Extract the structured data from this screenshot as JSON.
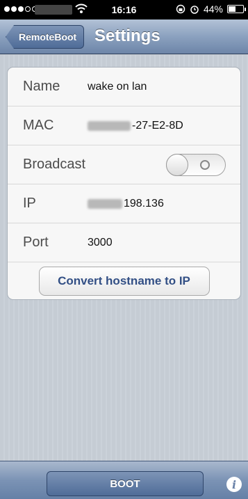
{
  "status_bar": {
    "time": "16:16",
    "battery_percent": "44%",
    "battery_level": 0.44,
    "icons": [
      "signal-icon",
      "wifi-icon",
      "rotation-lock-icon",
      "alarm-icon",
      "battery-icon"
    ]
  },
  "nav": {
    "back_label": "RemoteBoot",
    "title": "Settings"
  },
  "settings": {
    "name_label": "Name",
    "name_value": "wake on lan",
    "mac_label": "MAC",
    "mac_value": "-27-E2-8D",
    "broadcast_label": "Broadcast",
    "broadcast_enabled": false,
    "ip_label": "IP",
    "ip_value": "198.136",
    "port_label": "Port",
    "port_value": "3000",
    "convert_button": "Convert hostname to IP"
  },
  "toolbar": {
    "boot_label": "BOOT",
    "info_glyph": "i"
  },
  "colors": {
    "nav_gradient_top": "#b3c2d6",
    "nav_gradient_bottom": "#6d85a8",
    "button_text": "#324f85",
    "background": "#c5ccd4"
  }
}
